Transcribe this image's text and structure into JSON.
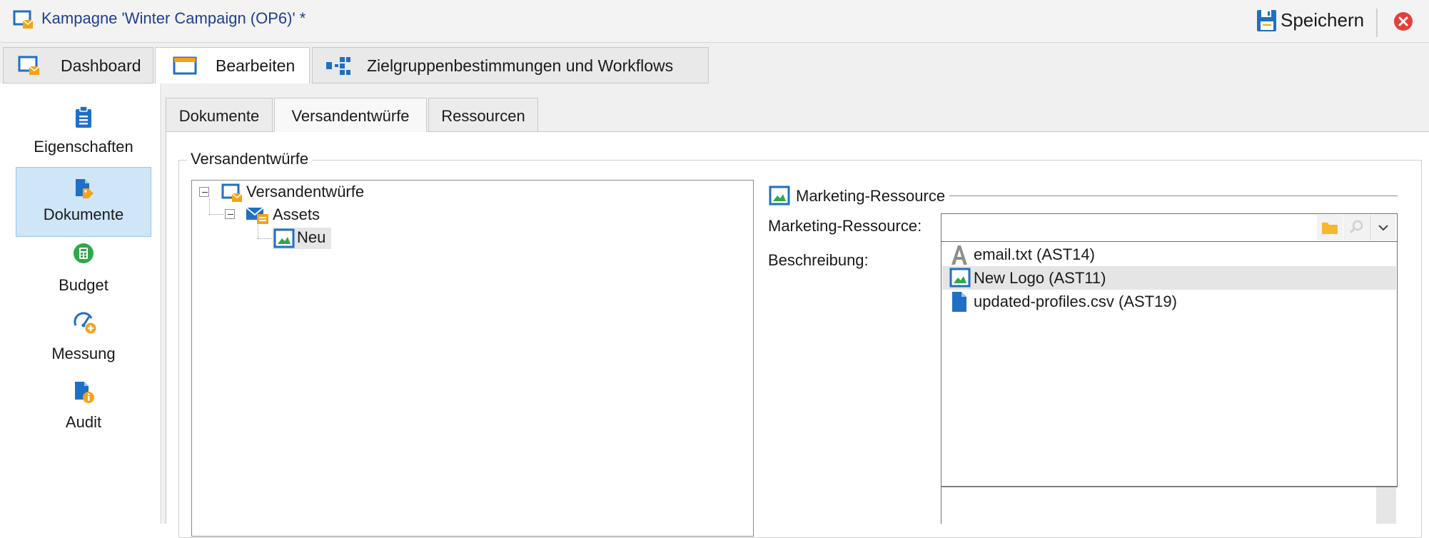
{
  "window": {
    "title": "Kampagne 'Winter Campaign (OP6)' *",
    "save_label": "Speichern"
  },
  "main_tabs": [
    {
      "label": "Dashboard",
      "active": false
    },
    {
      "label": "Bearbeiten",
      "active": true
    },
    {
      "label": "Zielgruppenbestimmungen und Workflows",
      "active": false
    }
  ],
  "sidebar": {
    "items": [
      {
        "label": "Eigenschaften",
        "icon": "clipboard-icon",
        "active": false
      },
      {
        "label": "Dokumente",
        "icon": "document-tag-icon",
        "active": true
      },
      {
        "label": "Budget",
        "icon": "calculator-icon",
        "active": false
      },
      {
        "label": "Messung",
        "icon": "gauge-icon",
        "active": false
      },
      {
        "label": "Audit",
        "icon": "document-info-icon",
        "active": false
      }
    ]
  },
  "sub_tabs": [
    {
      "label": "Dokumente",
      "active": false
    },
    {
      "label": "Versandentwürfe",
      "active": true
    },
    {
      "label": "Ressourcen",
      "active": false
    }
  ],
  "group": {
    "title": "Versandentwürfe"
  },
  "tree": {
    "root": {
      "label": "Versandentwürfe",
      "expanded": true
    },
    "child": {
      "label": "Assets",
      "expanded": true
    },
    "leaf": {
      "label": "Neu",
      "selected": true
    }
  },
  "marketing_resource": {
    "section_title": "Marketing-Ressource",
    "field_label": "Marketing-Ressource:",
    "field_value": "",
    "description_label": "Beschreibung:",
    "options": [
      {
        "label": "email.txt (AST14)",
        "icon": "text-file-icon",
        "highlighted": false
      },
      {
        "label": "New Logo (AST11)",
        "icon": "image-icon",
        "highlighted": true
      },
      {
        "label": "updated-profiles.csv (AST19)",
        "icon": "file-icon",
        "highlighted": false
      }
    ]
  },
  "colors": {
    "accent_blue": "#1f6fc5",
    "title_blue": "#1f3f8f",
    "orange": "#f5a21b",
    "close_red": "#e2413a",
    "green": "#2ea84a",
    "selected_nav_bg": "#cfe5f8"
  }
}
